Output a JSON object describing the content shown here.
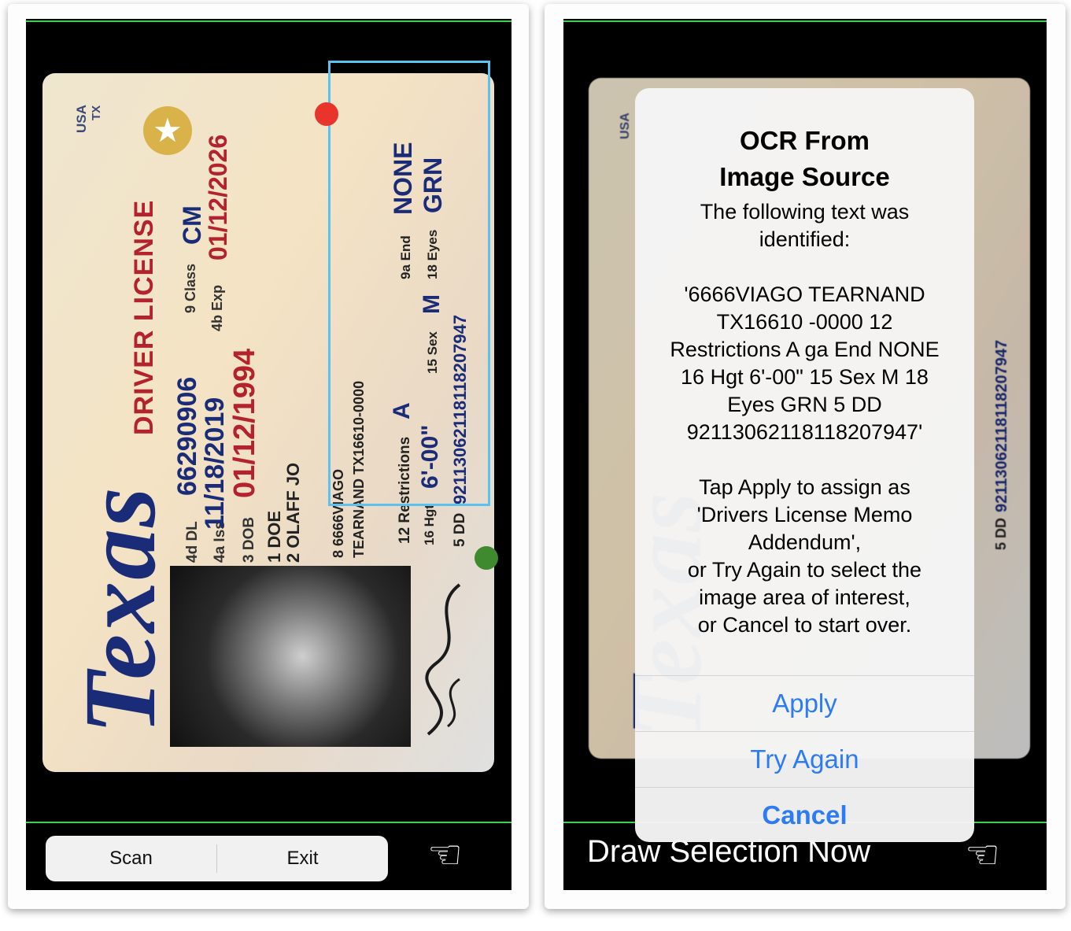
{
  "license": {
    "country": "USA",
    "state_abbr": "TX",
    "state_word": "Texas",
    "title": "DRIVER LICENSE",
    "class_field": "9 Class",
    "class_value": "CM",
    "exp_field": "4b Exp",
    "exp_value": "01/12/2026",
    "dl_field": "4d DL",
    "dl_value": "66290906",
    "iss_field": "4a Iss",
    "iss_value": "11/18/2019",
    "dob_field": "3 DOB",
    "dob_value": "01/12/1994",
    "name_last": "1 DOE",
    "name_first": "2 OLAFF JO",
    "address_line1": "8 6666VIAGO",
    "address_line2": "TEARNAND TX16610-0000",
    "end_field": "9a End",
    "end_value": "NONE",
    "eyes_field": "18 Eyes",
    "eyes_value": "GRN",
    "restrictions_field": "12 Restrictions",
    "restrictions_value": "A",
    "sex_field": "15 Sex",
    "sex_value": "M",
    "hgt_field": "16 Hgt",
    "hgt_value": "6'-00\"",
    "dd_field": "5 DD",
    "dd_value": "92113062118118207947"
  },
  "toolbar": {
    "scan_label": "Scan",
    "exit_label": "Exit",
    "hand_icon": "pointing-hand-icon"
  },
  "alert": {
    "title_line1": "OCR From",
    "title_line2": "Image Source",
    "msg_line1": "The following text was",
    "msg_line2": "identified:",
    "ocr_line1": "'6666VIAGO TEARNAND",
    "ocr_line2": "TX16610 -0000 12",
    "ocr_line3": "Restrictions A ga End NONE",
    "ocr_line4": "16 Hgt 6'-00\" 15 Sex M 18",
    "ocr_line5": "Eyes GRN 5 DD",
    "ocr_line6": "92113062118118207947'",
    "tap_line1": "Tap Apply to assign as",
    "tap_line2": "'Drivers License Memo",
    "tap_line3": "Addendum',",
    "tap_line4": "or Try Again to select the",
    "tap_line5": "image area of interest,",
    "tap_line6": "or Cancel to start over.",
    "apply_label": "Apply",
    "try_again_label": "Try Again",
    "cancel_label": "Cancel"
  },
  "status": {
    "draw_selection": "Draw Selection Now"
  },
  "colors": {
    "accent_blue": "#2d7cf6",
    "selection_blue": "#5bc2f0",
    "handle_red": "#e8342a",
    "handle_green": "#3f8a2f",
    "license_red": "#b3222d",
    "license_navy": "#1a2c78",
    "separator_green": "#3bd14a"
  }
}
